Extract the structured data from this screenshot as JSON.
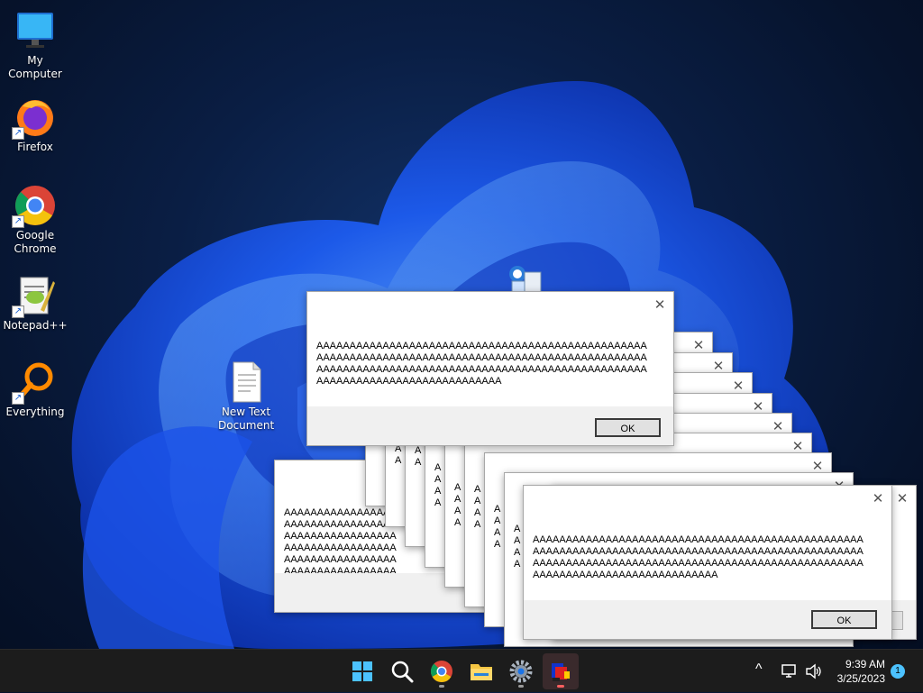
{
  "desktop": {
    "icons": [
      {
        "label": "My Computer"
      },
      {
        "label": "Firefox"
      },
      {
        "label": "Google Chrome"
      },
      {
        "label": "Notepad++"
      },
      {
        "label": "Everything"
      },
      {
        "label": "New Text Document"
      }
    ]
  },
  "dialogs": {
    "message": "AAAAAAAAAAAAAAAAAAAAAAAAAAAAAAAAAAAAAAAAAAAAAAAAAAAAAAAAAAAAAAAAAAAAAAAAAAAAAAAAAAAAAAAAAAAAAAAAAAAAAAAAAAAAAAAAAAAAAAAAAAAAAAAAAAAAAAAAAAAAAAAAAAAAAAAAAAAAAAAAAAAAAAAAAAAAAAAAAA",
    "close_glyph": "✕",
    "ok_label": "OK"
  },
  "taskbar": {
    "apps": [
      "start-icon",
      "search-icon",
      "chrome-icon",
      "file-explorer-icon",
      "settings-icon",
      "app-icon"
    ],
    "time": "9:39 AM",
    "date": "3/25/2023",
    "notification_count": "1",
    "tray_chevron": "^"
  },
  "colors": {
    "accent": "#1a6cff",
    "taskbar": "#1c1c1c",
    "badge": "#4cc2ff"
  }
}
